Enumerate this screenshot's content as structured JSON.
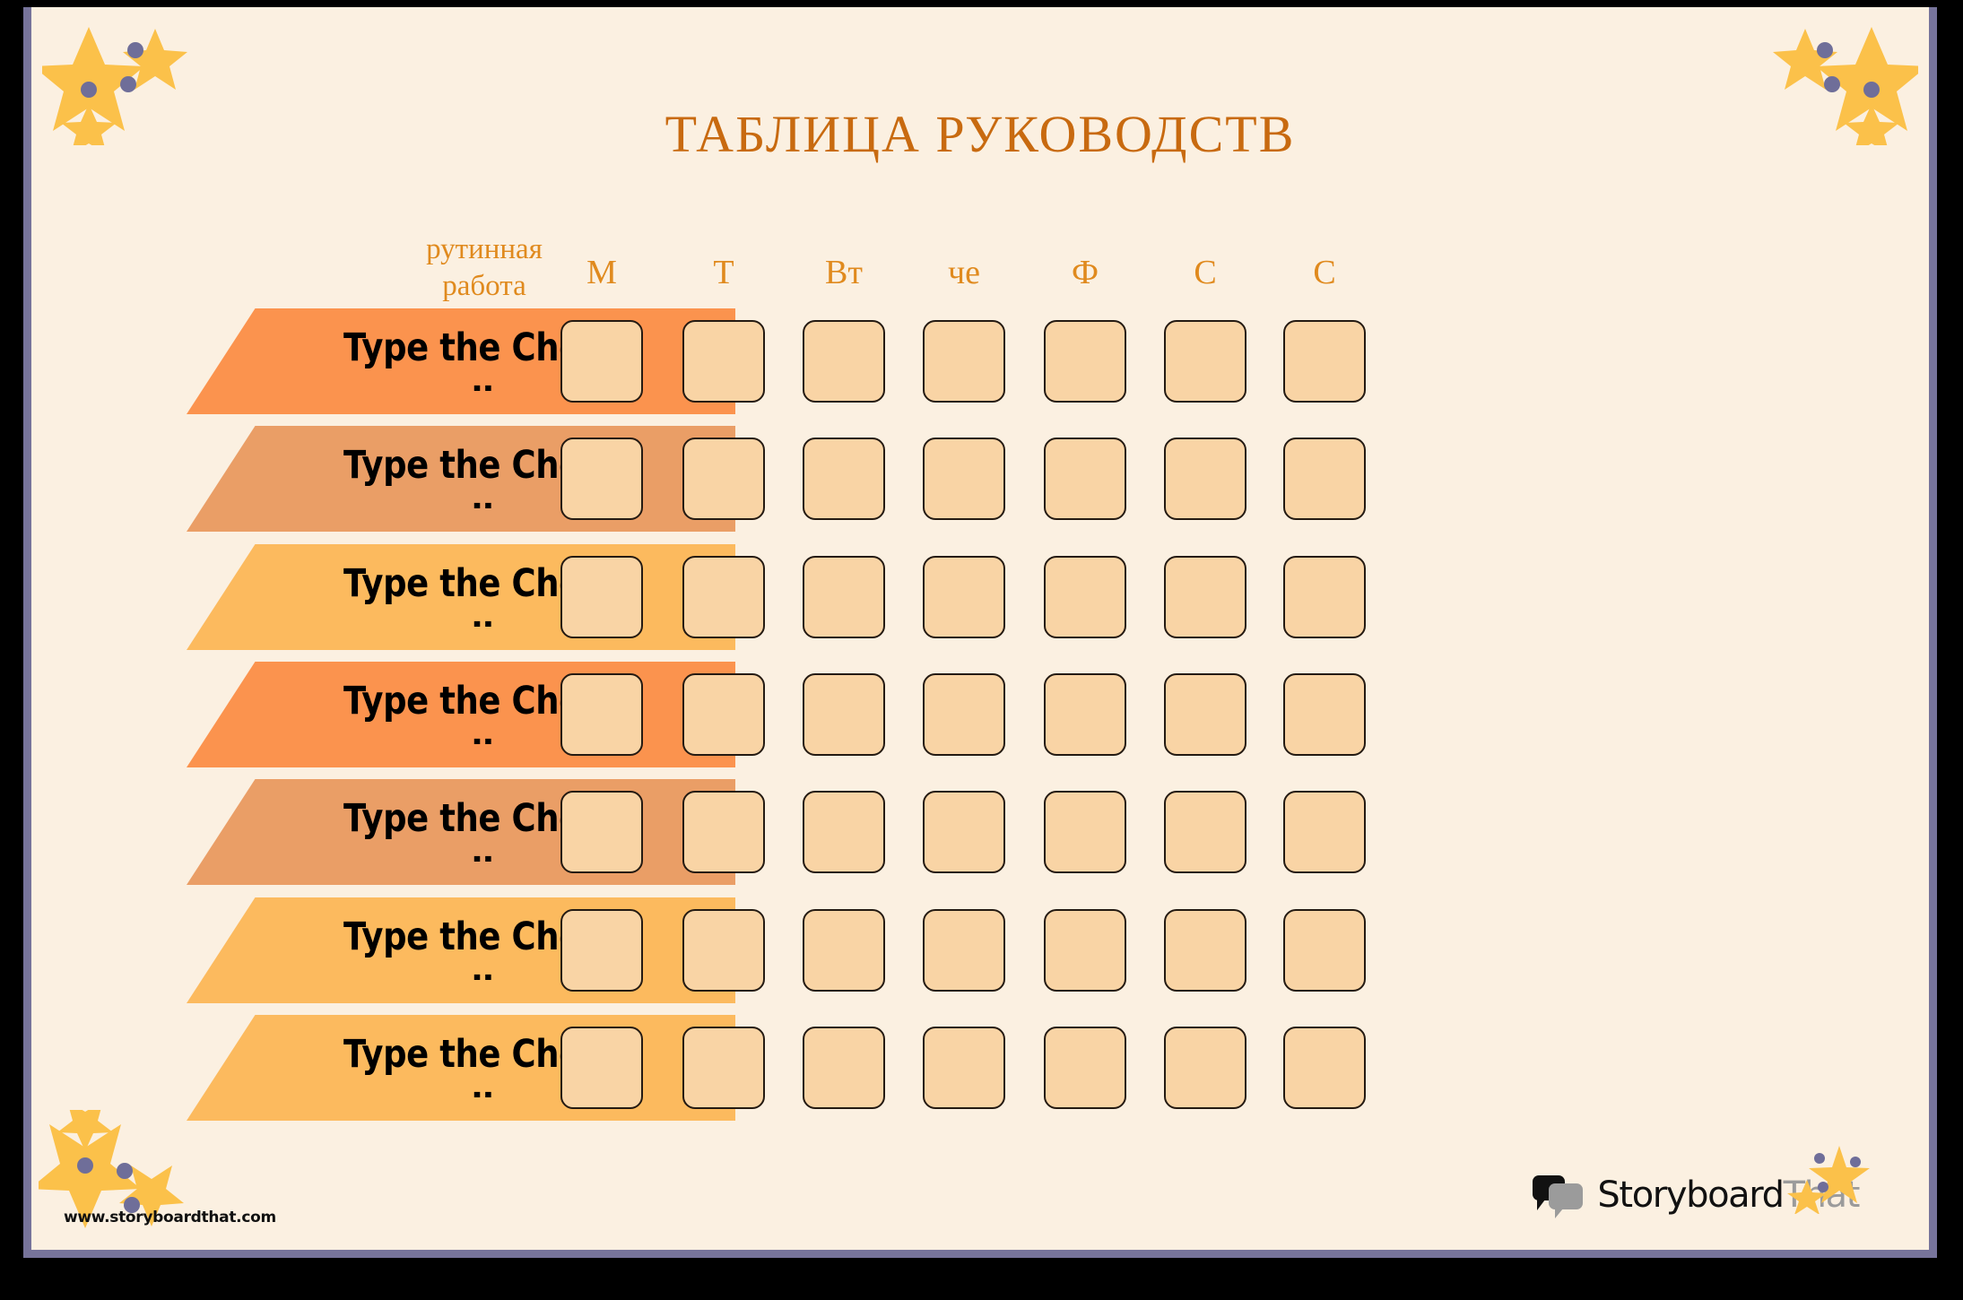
{
  "page": {
    "title": "ТАБЛИЦА РУКОВОДСТВ",
    "background_color": "#FBF0E1",
    "frame_color": "#77749B",
    "title_color": "#C86A10"
  },
  "table": {
    "chore_header": {
      "line1": "рутинная",
      "line2": "работа"
    },
    "day_headers": [
      {
        "label": "М"
      },
      {
        "label": "Т"
      },
      {
        "label": "Вт"
      },
      {
        "label": "че"
      },
      {
        "label": "Ф"
      },
      {
        "label": "С"
      },
      {
        "label": "С"
      }
    ],
    "rows": [
      {
        "label": "Type the Chore",
        "sublabel": "..",
        "color": "#FB934E"
      },
      {
        "label": "Type the Chore",
        "sublabel": "..",
        "color": "#EA9E66"
      },
      {
        "label": "Type the Chore",
        "sublabel": "..",
        "color": "#FCBA5E"
      },
      {
        "label": "Type the Chore",
        "sublabel": "..",
        "color": "#FB934E"
      },
      {
        "label": "Type the Chore",
        "sublabel": "..",
        "color": "#EA9E66"
      },
      {
        "label": "Type the Chore",
        "sublabel": "..",
        "color": "#FCBA5E"
      },
      {
        "label": "Type the Chore",
        "sublabel": "..",
        "color": "#FCBA5E"
      }
    ],
    "checkbox": {
      "fill": "#F9D4A5",
      "border": "#241A12",
      "checked": false
    }
  },
  "decor": {
    "star_color": "#FBC14A",
    "dot_color": "#6F6E99"
  },
  "footer": {
    "watermark": "www.storyboardthat.com",
    "logo_text_dark": "Storyboard",
    "logo_text_grey": "That"
  }
}
